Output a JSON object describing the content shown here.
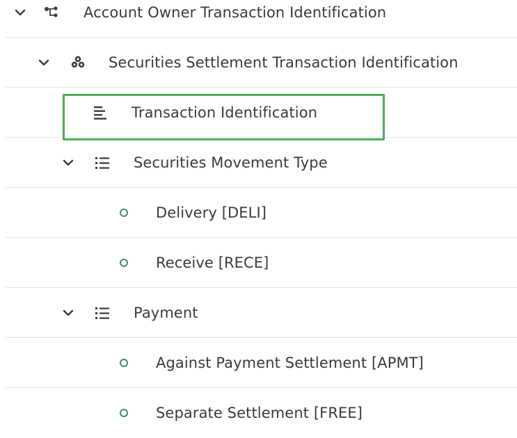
{
  "tree": {
    "items": [
      {
        "label": "Account Owner Transaction Identification",
        "icon": "hierarchy-icon",
        "expanded": true
      },
      {
        "label": "Securities Settlement Transaction Identification",
        "icon": "group-icon",
        "expanded": true
      },
      {
        "label": "Transaction Identification",
        "icon": "text-lines-icon",
        "selected": true
      },
      {
        "label": "Securities Movement Type",
        "icon": "list-icon",
        "expanded": true
      },
      {
        "label": "Delivery [DELI]",
        "icon": "radio-option-icon"
      },
      {
        "label": "Receive [RECE]",
        "icon": "radio-option-icon"
      },
      {
        "label": "Payment",
        "icon": "list-icon",
        "expanded": true
      },
      {
        "label": "Against Payment Settlement [APMT]",
        "icon": "radio-option-icon"
      },
      {
        "label": "Separate Settlement [FREE]",
        "icon": "radio-option-icon"
      }
    ]
  },
  "colors": {
    "selection_border": "#4cae56",
    "radio_ring": "#3a8f6a",
    "divider": "#e3e3e3",
    "text": "#3a3a3a"
  }
}
